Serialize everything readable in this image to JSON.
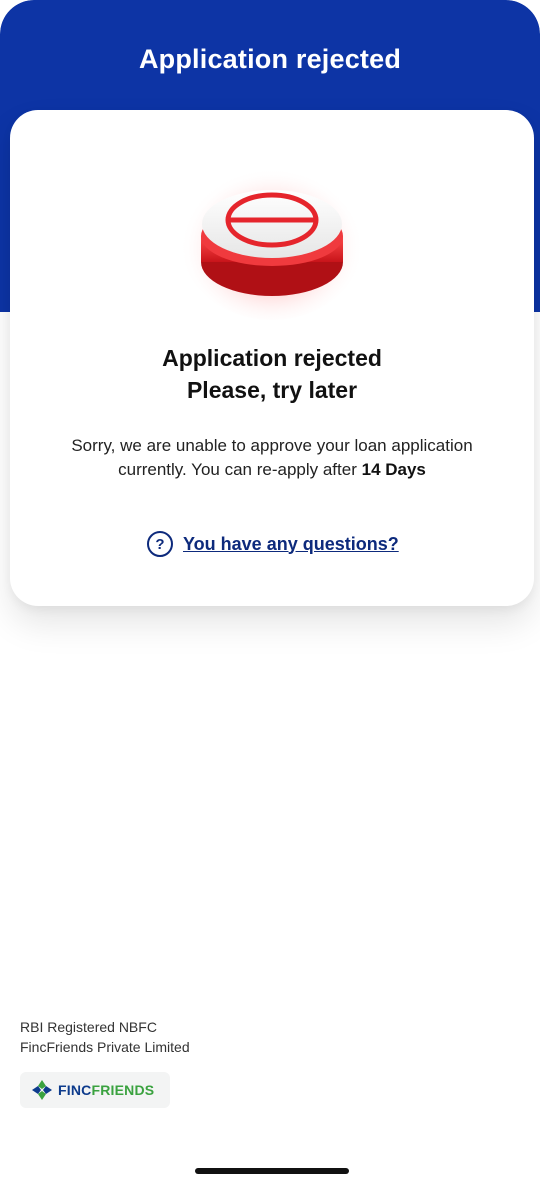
{
  "header": {
    "title": "Application rejected"
  },
  "card": {
    "icon": "rejected-stop-button-icon",
    "title_line1": "Application rejected",
    "title_line2": "Please, try later",
    "message_part1": "Sorry, we are unable to approve your loan application currently.  You can re-apply after ",
    "message_days": "14 Days",
    "questions_icon": "question-circle-icon",
    "questions_link": "You have any questions?",
    "questions_icon_glyph": "?"
  },
  "footer": {
    "line1": "RBI Registered NBFC",
    "line2": "FincFriends Private Limited",
    "logo_part1": "FINC",
    "logo_part2": "FRIENDS"
  },
  "colors": {
    "header_blue": "#0d34a5",
    "link_navy": "#0d2a7c",
    "reject_red": "#e5252c",
    "logo_blue": "#0d3b8c",
    "logo_green": "#3aa23f"
  }
}
